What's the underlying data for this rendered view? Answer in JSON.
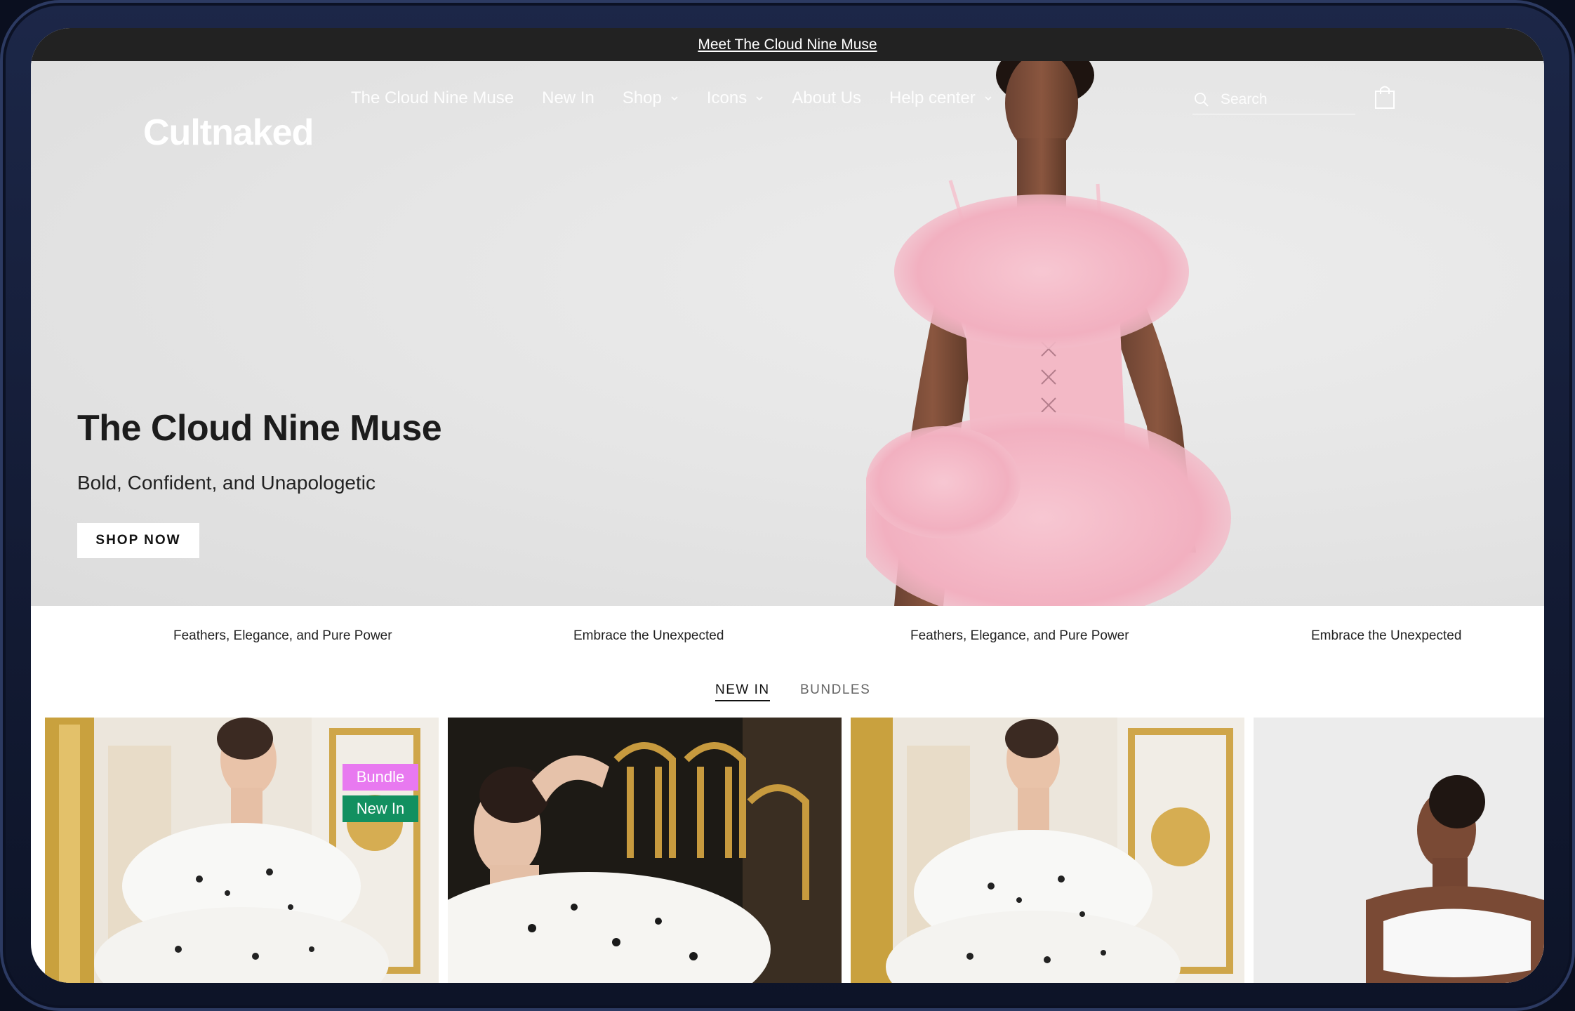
{
  "announcement": {
    "text": "Meet The Cloud Nine Muse"
  },
  "header": {
    "logo": "Cultnaked",
    "nav": [
      {
        "label": "The Cloud Nine Muse",
        "dropdown": false
      },
      {
        "label": "New In",
        "dropdown": false
      },
      {
        "label": "Shop",
        "dropdown": true
      },
      {
        "label": "Icons",
        "dropdown": true
      },
      {
        "label": "About Us",
        "dropdown": false
      },
      {
        "label": "Help center",
        "dropdown": true
      }
    ],
    "search_placeholder": "Search",
    "icons": {
      "search": "search-icon",
      "cart": "shopping-bag-icon",
      "dropdown": "chevron-down-icon"
    }
  },
  "hero": {
    "title": "The Cloud Nine Muse",
    "subtitle": "Bold, Confident, and Unapologetic",
    "cta": "SHOP NOW"
  },
  "marquee": {
    "items": [
      "Feathers, Elegance, and Pure Power",
      "Embrace the Unexpected",
      "Feathers, Elegance, and Pure Power",
      "Embrace the Unexpected"
    ]
  },
  "tabs": [
    {
      "label": "NEW IN",
      "active": true
    },
    {
      "label": "BUNDLES",
      "active": false
    }
  ],
  "products": {
    "badges": [
      {
        "label": "Bundle",
        "color": "#e879f0"
      },
      {
        "label": "New In",
        "color": "#129060"
      }
    ]
  },
  "colors": {
    "announcement_bg": "#222222",
    "hero_bg": "#e6e6e6",
    "text_dark": "#1c1c1c",
    "dress_pink": "#f2b6c4"
  }
}
